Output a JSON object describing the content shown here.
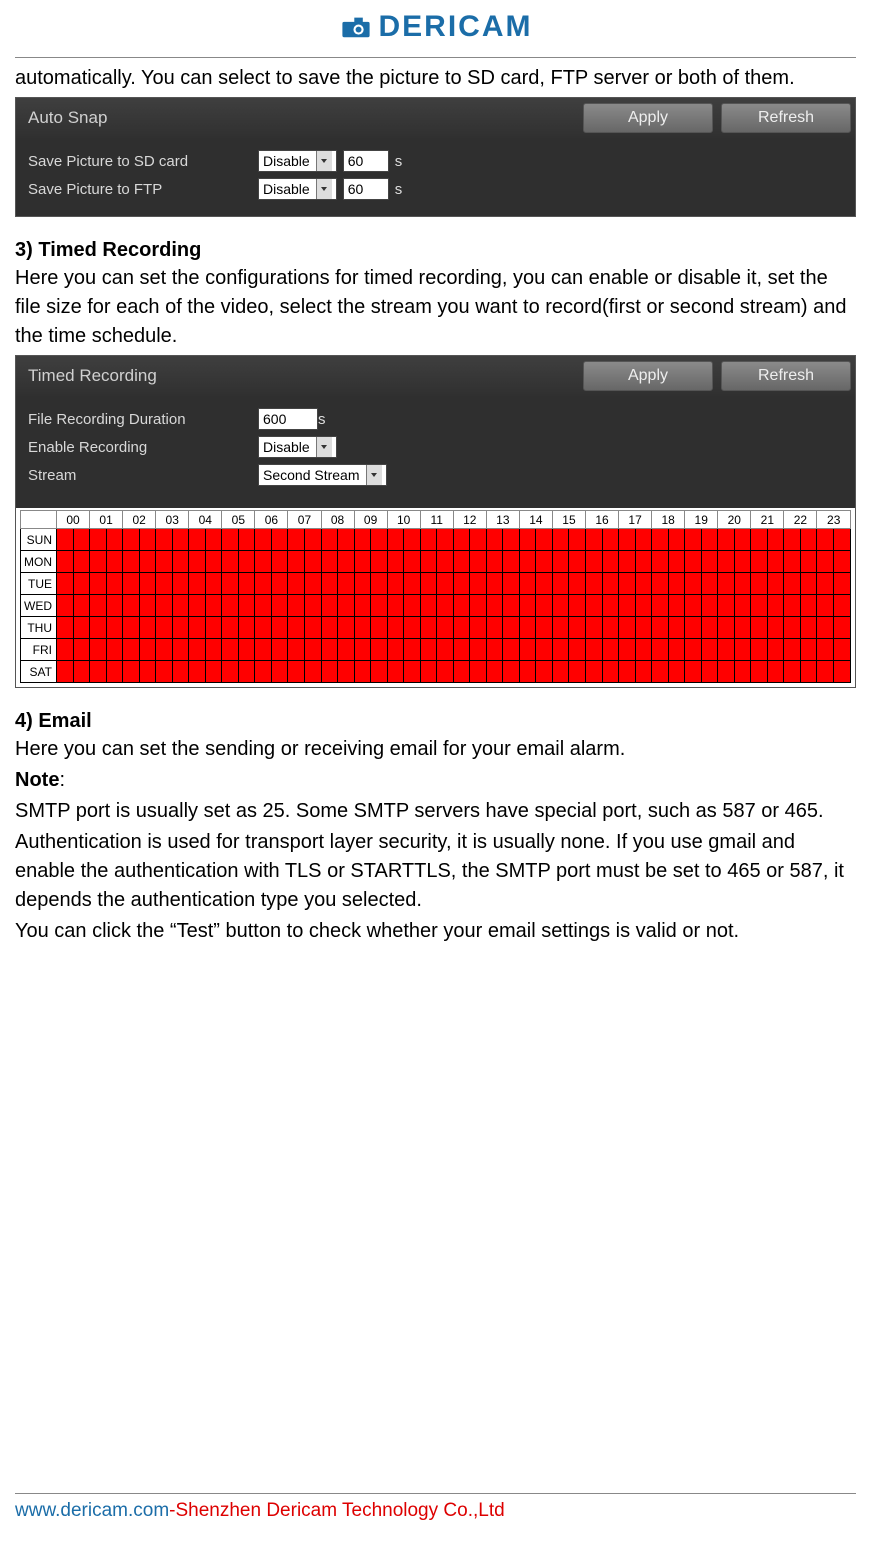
{
  "logo": {
    "text": "DERICAM"
  },
  "intro_text": "automatically. You can select to save the picture to SD card, FTP server or both of them.",
  "autosnap": {
    "title": "Auto Snap",
    "apply": "Apply",
    "refresh": "Refresh",
    "row1_label": "Save Picture to SD card",
    "row1_sel": "Disable",
    "row1_val": "60",
    "row1_unit": "s",
    "row2_label": "Save Picture to FTP",
    "row2_sel": "Disable",
    "row2_val": "60",
    "row2_unit": "s"
  },
  "sec3": {
    "head": "3) Timed Recording",
    "desc": "Here you can set the configurations for timed recording, you can enable or disable it, set the file size for each of the video, select the stream you want to record(first or second stream) and the time schedule."
  },
  "timed": {
    "title": "Timed Recording",
    "apply": "Apply",
    "refresh": "Refresh",
    "r1_label": "File Recording Duration",
    "r1_val": "600",
    "r1_unit": "s",
    "r2_label": "Enable Recording",
    "r2_sel": "Disable",
    "r3_label": "Stream",
    "r3_sel": "Second Stream"
  },
  "schedule": {
    "hours": [
      "00",
      "01",
      "02",
      "03",
      "04",
      "05",
      "06",
      "07",
      "08",
      "09",
      "10",
      "11",
      "12",
      "13",
      "14",
      "15",
      "16",
      "17",
      "18",
      "19",
      "20",
      "21",
      "22",
      "23"
    ],
    "days": [
      "SUN",
      "MON",
      "TUE",
      "WED",
      "THU",
      "FRI",
      "SAT"
    ]
  },
  "sec4": {
    "head": "4) Email",
    "l1": "Here you can set the sending or receiving email for your email alarm.",
    "note_label": "Note",
    "note_colon": ":",
    "l2": "SMTP port is usually set as 25. Some SMTP servers have special port, such as 587 or 465.",
    "l3": "Authentication is used for transport layer security, it is usually none. If you use gmail and enable the authentication with TLS or STARTTLS, the SMTP port must be set to 465 or 587, it depends the authentication type you selected.",
    "l4": "You can click the “Test” button to check whether your email settings is valid or not."
  },
  "footer": {
    "link": "www.dericam.com",
    "dash": "-",
    "co": "Shenzhen Dericam Technology Co.,Ltd"
  }
}
